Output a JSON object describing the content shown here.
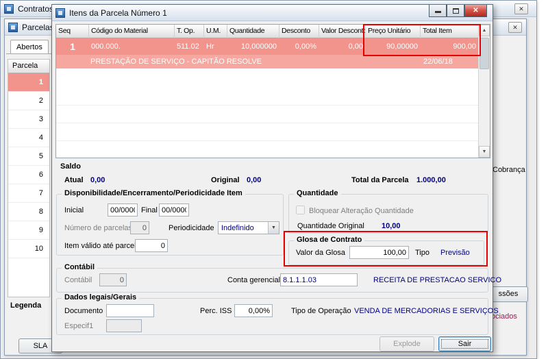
{
  "colors": {
    "row_highlight": "#f2938c",
    "row_highlight_light": "#f5a7a0",
    "annotation_red": "#e60000",
    "value_navy": "#000080"
  },
  "icons": {
    "close": "✕",
    "scroll_up": "▲",
    "scroll_down": "▼",
    "combo_arrow": "▼"
  },
  "bg": {
    "win1_title": "Contratos",
    "win2_title": "Parcelas do",
    "tab_abertos": "Abertos",
    "list_header": "Parcela",
    "rows": [
      "1",
      "2",
      "3",
      "4",
      "5",
      "6",
      "7",
      "8",
      "9",
      "10"
    ],
    "legenda": "Legenda",
    "sla": "SLA",
    "frag_cobranca": "Cobrança",
    "frag_ssoes": "ssões",
    "frag_ociados": "ociados"
  },
  "dlg": {
    "title": "Itens da Parcela Número 1",
    "grid": {
      "headers": [
        "Seq",
        "Código do Material",
        "T. Op.",
        "U.M.",
        "Quantidade",
        "Desconto",
        "Valor Desconto",
        "Preço Unitário",
        "Total Item"
      ],
      "row": {
        "seq": "1",
        "codigo_material": "000.000.",
        "t_op": "511.02",
        "um": "Hr",
        "quantidade": "10,000000",
        "desconto": "0,00%",
        "valor_desconto": "0,00",
        "preco_unitario": "90,00000",
        "total_item": "900,00"
      },
      "desc": "PRESTAÇÃO DE SERVIÇO - CAPITÃO RESOLVE",
      "date": "22/06/18"
    },
    "saldo": {
      "title": "Saldo",
      "atual": "Atual",
      "atual_v": "0,00",
      "original": "Original",
      "original_v": "0,00",
      "total": "Total da Parcela",
      "total_v": "1.000,00"
    },
    "disp": {
      "title": "Disponibilidade/Encerramento/Periodicidade Item",
      "inicial": "Inicial",
      "inicial_v": "00/0000",
      "final": "Final",
      "final_v": "00/0000",
      "nparc": "Número de parcelas",
      "nparc_v": "0",
      "period": "Periodicidade",
      "period_v": "Indefinido",
      "item_valido": "Item válido até parcela",
      "item_valido_v": "0"
    },
    "qtd": {
      "title": "Quantidade",
      "bloquear": "Bloquear Alteração Quantidade",
      "orig": "Quantidade Original",
      "orig_v": "10,00"
    },
    "glosa": {
      "title": "Glosa de Contrato",
      "valor": "Valor da Glosa",
      "valor_v": "100,00",
      "tipo": "Tipo",
      "tipo_v": "Previsão"
    },
    "contabil": {
      "title": "Contábil",
      "lbl": "Contábil",
      "val": "0",
      "conta_lbl": "Conta gerencial",
      "conta_val": "8.1.1.1.03",
      "conta_desc": "RECEITA DE PRESTACAO SERVICO"
    },
    "legais": {
      "title": "Dados legais/Gerais",
      "doc": "Documento",
      "perciss": "Perc. ISS",
      "perciss_v": "0,00%",
      "tipoop": "Tipo de Operação",
      "tipoop_v": "VENDA DE MERCADORIAS E SERVIÇOS",
      "especif": "Especif1"
    },
    "btn_explode": "Explode",
    "btn_sair": "Sair"
  }
}
